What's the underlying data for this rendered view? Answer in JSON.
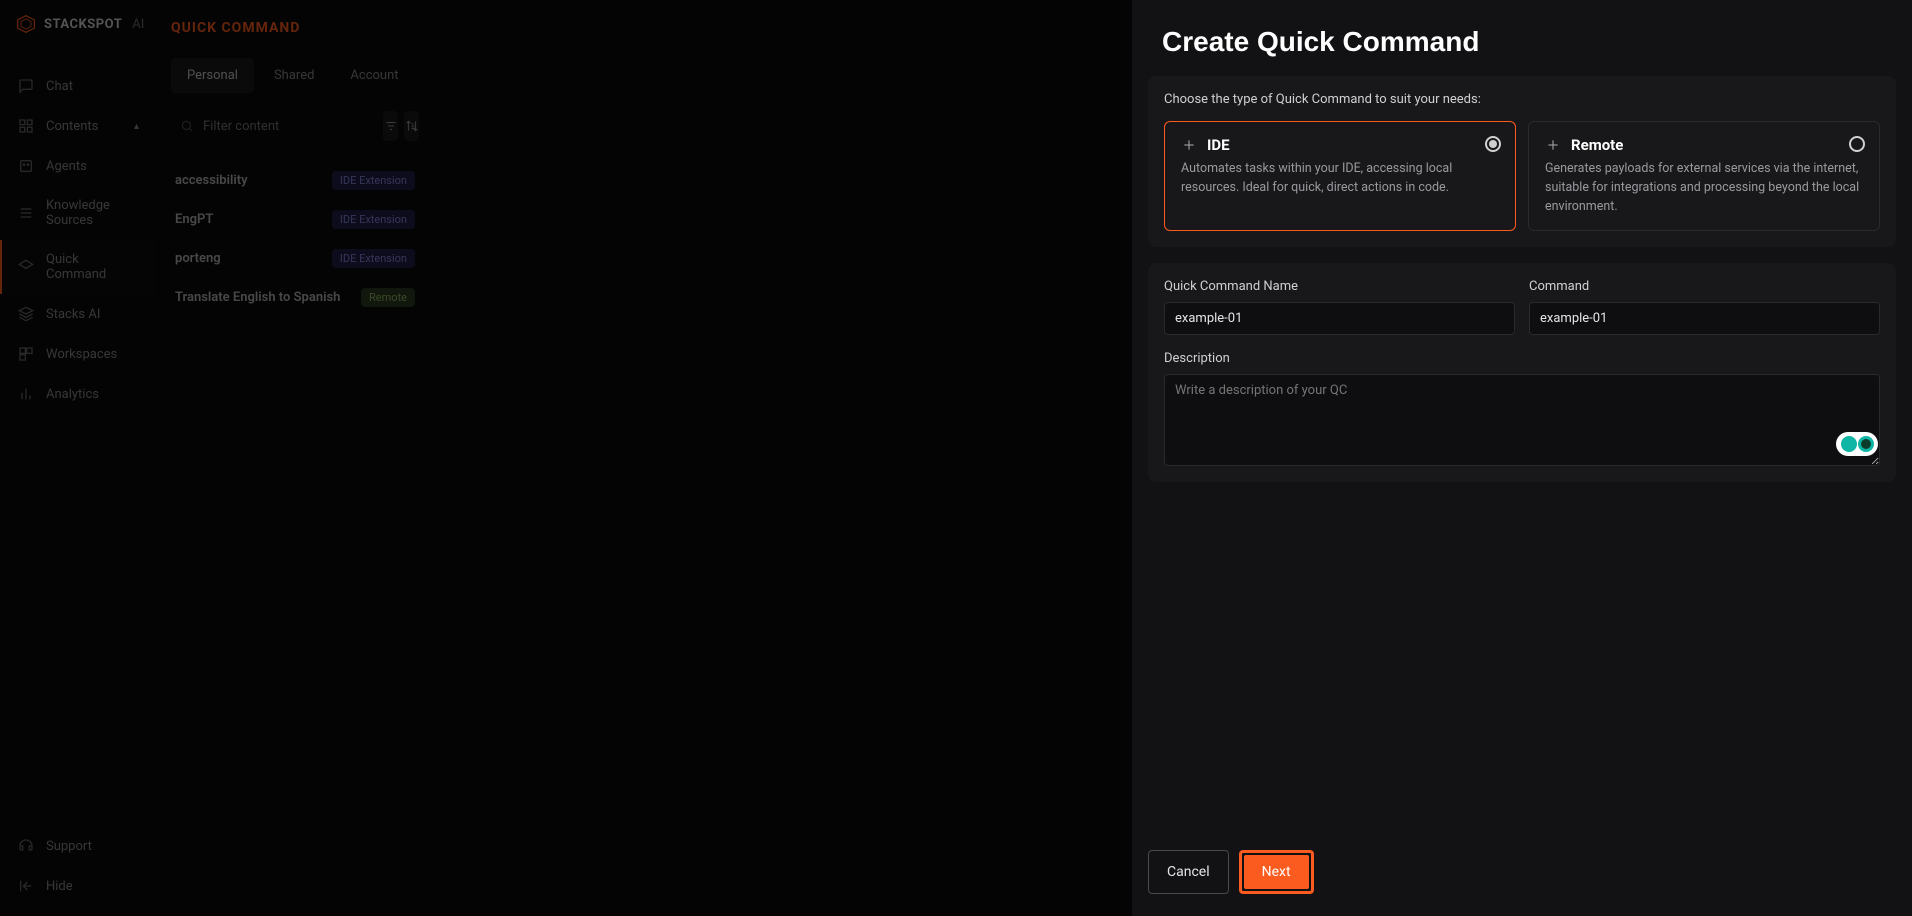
{
  "logo": {
    "brand": "STACKSPOT",
    "suffix": "AI"
  },
  "sidebar": {
    "items": [
      {
        "label": "Chat"
      },
      {
        "label": "Contents"
      },
      {
        "label": "Agents"
      },
      {
        "label": "Knowledge Sources"
      },
      {
        "label": "Quick Command"
      },
      {
        "label": "Stacks AI"
      },
      {
        "label": "Workspaces"
      },
      {
        "label": "Analytics"
      }
    ],
    "support": "Support",
    "hide": "Hide"
  },
  "content": {
    "title": "QUICK COMMAND",
    "tabs": [
      "Personal",
      "Shared",
      "Account"
    ],
    "filter_placeholder": "Filter content",
    "items": [
      {
        "name": "accessibility",
        "badge": "IDE Extension",
        "badge_type": "ide"
      },
      {
        "name": "EngPT",
        "badge": "IDE Extension",
        "badge_type": "ide"
      },
      {
        "name": "porteng",
        "badge": "IDE Extension",
        "badge_type": "ide"
      },
      {
        "name": "Translate English to Spanish",
        "badge": "Remote",
        "badge_type": "remote"
      }
    ]
  },
  "modal": {
    "title": "Create Quick Command",
    "type_prompt": "Choose the type of Quick Command to suit your needs:",
    "cards": [
      {
        "title": "IDE",
        "desc": "Automates tasks within your IDE, accessing local resources. Ideal for quick, direct actions in code."
      },
      {
        "title": "Remote",
        "desc": "Generates payloads for external services via the internet, suitable for integrations and processing beyond the local environment."
      }
    ],
    "form": {
      "name_label": "Quick Command Name",
      "name_value": "example-01",
      "command_label": "Command",
      "command_value": "example-01",
      "desc_label": "Description",
      "desc_placeholder": "Write a description of your QC"
    },
    "cancel": "Cancel",
    "next": "Next"
  }
}
